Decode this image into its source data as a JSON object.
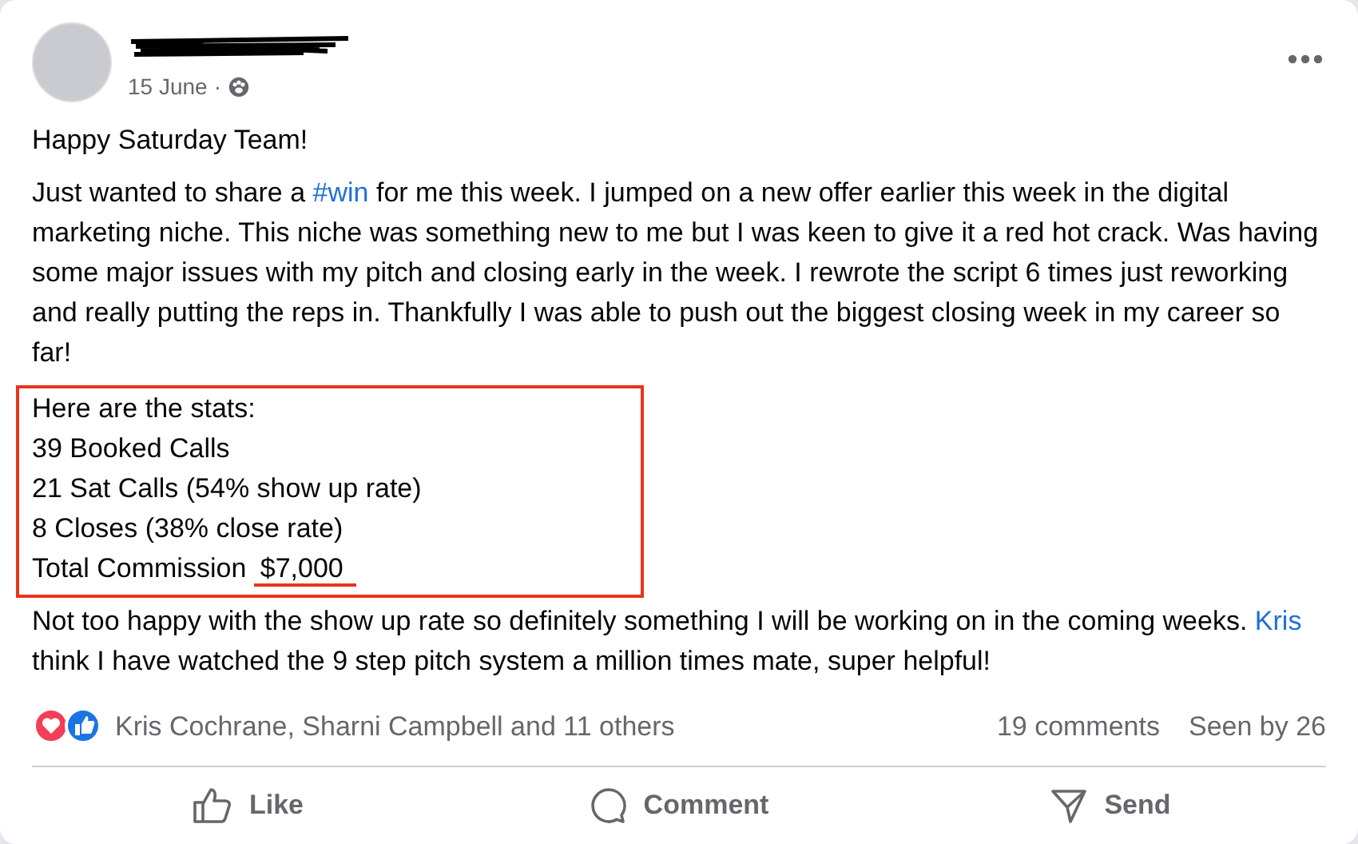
{
  "post": {
    "date": "15 June",
    "separator": "·",
    "author_redacted": true,
    "paragraphs": [
      [
        {
          "kind": "text",
          "text": "Happy Saturday Team!"
        }
      ],
      [
        {
          "kind": "text",
          "text": "Just wanted to share a "
        },
        {
          "kind": "link",
          "text": "#win"
        },
        {
          "kind": "text",
          "text": " for me this week. I jumped on a new offer earlier this week in the digital marketing niche. This niche was something new to me but I was keen to give it a red hot crack. Was having some major issues with my pitch and closing early in the week. I rewrote the script 6 times just reworking and really putting the reps in. Thankfully I was able to push out the biggest closing week in my career so far!"
        }
      ]
    ],
    "stats": [
      [
        {
          "kind": "text",
          "text": "Here are the stats:"
        }
      ],
      [
        {
          "kind": "text",
          "text": "39 Booked Calls"
        }
      ],
      [
        {
          "kind": "text",
          "text": "21 Sat Calls (54% show up rate)"
        }
      ],
      [
        {
          "kind": "text",
          "text": "8 Closes (38% close rate)"
        }
      ],
      [
        {
          "kind": "text",
          "text": "Total Commission "
        },
        {
          "kind": "underlined",
          "text": "$7,000"
        }
      ]
    ],
    "closing": [
      {
        "kind": "text",
        "text": "Not too happy with the show up rate so definitely something I will be working on in the coming weeks. "
      },
      {
        "kind": "link",
        "text": "Kris"
      },
      {
        "kind": "text",
        "text": " think I have watched the 9 step pitch system a million times mate, super helpful!"
      }
    ]
  },
  "reactions": {
    "names": "Kris Cochrane, Sharni Campbell and 11 others",
    "comments": "19 comments",
    "seen": "Seen by 26"
  },
  "actions": [
    {
      "kind": "like",
      "label": "Like"
    },
    {
      "kind": "comment",
      "label": "Comment"
    },
    {
      "kind": "send",
      "label": "Send"
    }
  ]
}
